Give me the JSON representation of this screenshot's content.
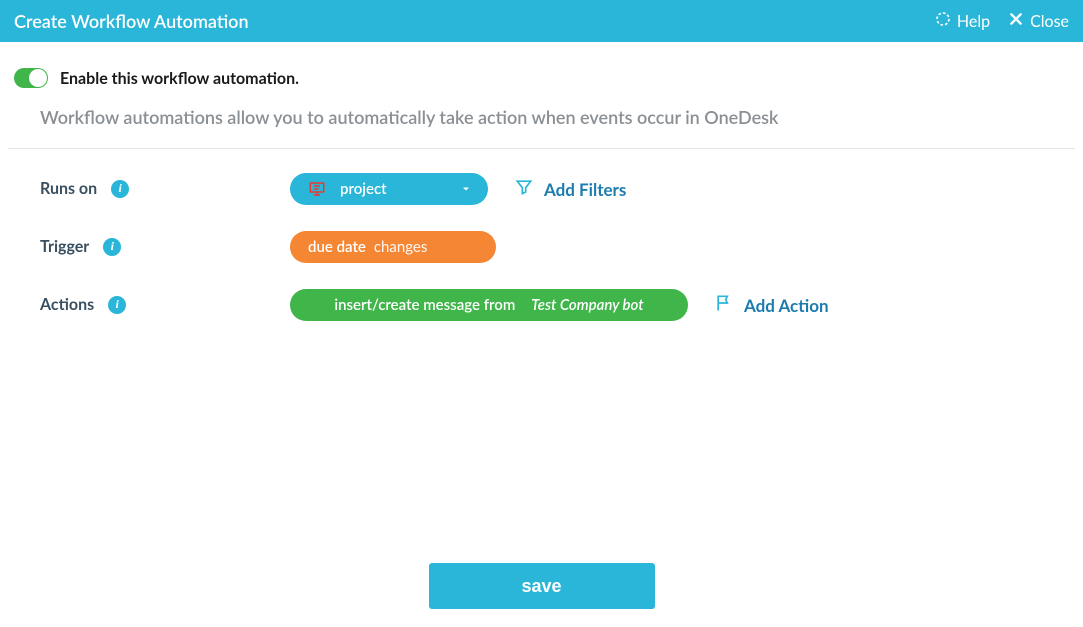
{
  "header": {
    "title": "Create Workflow Automation",
    "help_label": "Help",
    "close_label": "Close"
  },
  "enable": {
    "label": "Enable this workflow automation.",
    "on": true
  },
  "description": "Workflow automations allow you to automatically take action when events occur in OneDesk",
  "rows": {
    "runs_on": {
      "label": "Runs on",
      "selected": "project",
      "add_filters": "Add Filters"
    },
    "trigger": {
      "label": "Trigger",
      "field": "due date",
      "operator": "changes"
    },
    "actions": {
      "label": "Actions",
      "action_prefix": "insert/create message from",
      "action_value": "Test Company bot",
      "add_action": "Add Action"
    }
  },
  "footer": {
    "save": "save"
  },
  "colors": {
    "brand": "#29b6d8",
    "orange": "#f58634",
    "green": "#3fb54a"
  }
}
